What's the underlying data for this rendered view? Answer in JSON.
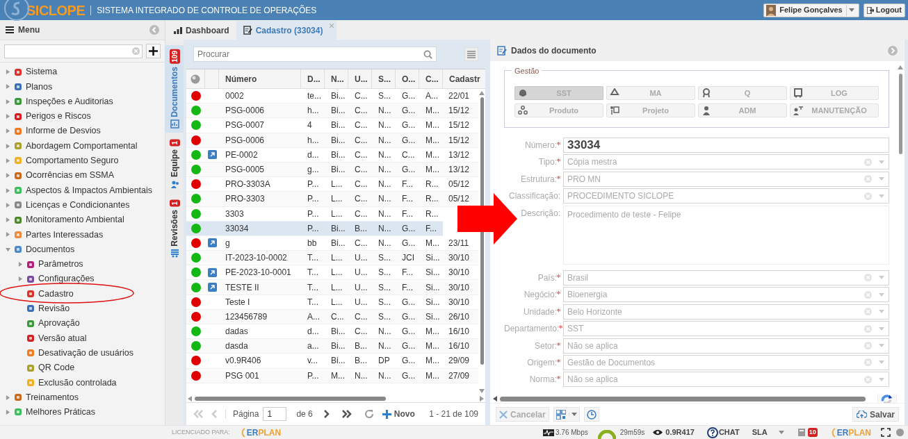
{
  "header": {
    "logo": "SICLOPE",
    "title": "SISTEMA INTEGRADO DE CONTROLE DE OPERAÇÕES",
    "user": "Felipe Gonçalves",
    "logout": "Logout"
  },
  "sidebar": {
    "title": "Menu",
    "items": [
      {
        "label": "Sistema",
        "expanded": false
      },
      {
        "label": "Planos",
        "expanded": false
      },
      {
        "label": "Inspeções e Auditorias",
        "expanded": false
      },
      {
        "label": "Perigos e Riscos",
        "expanded": false
      },
      {
        "label": "Informe de Desvios",
        "expanded": false
      },
      {
        "label": "Abordagem Comportamental",
        "expanded": false
      },
      {
        "label": "Comportamento Seguro",
        "expanded": false
      },
      {
        "label": "Ocorrências em SSMA",
        "expanded": false
      },
      {
        "label": "Aspectos & Impactos Ambientais",
        "expanded": false
      },
      {
        "label": "Licenças e Condicionantes",
        "expanded": false
      },
      {
        "label": "Monitoramento Ambiental",
        "expanded": false
      },
      {
        "label": "Partes Interessadas",
        "expanded": false
      },
      {
        "label": "Documentos",
        "expanded": true,
        "children": [
          {
            "label": "Parâmetros",
            "expanded": false
          },
          {
            "label": "Configurações",
            "expanded": false
          },
          {
            "label": "Cadastro"
          },
          {
            "label": "Revisão"
          },
          {
            "label": "Aprovação"
          },
          {
            "label": "Versão atual"
          },
          {
            "label": "Desativação de usuários"
          },
          {
            "label": "QR Code"
          },
          {
            "label": "Exclusão controlada"
          }
        ]
      },
      {
        "label": "Treinamentos",
        "expanded": false
      },
      {
        "label": "Melhores Práticas",
        "expanded": false
      }
    ]
  },
  "tabs": [
    {
      "label": "Dashboard",
      "selected": false,
      "closable": false
    },
    {
      "label": "Cadastro (33034)",
      "selected": true,
      "closable": true
    }
  ],
  "side_tabs": [
    {
      "label": "Documentos",
      "badge": "109",
      "selected": true
    },
    {
      "label": "Equipe",
      "badge": "1",
      "selected": false
    },
    {
      "label": "Revisões",
      "badge": "1",
      "selected": false
    }
  ],
  "grid": {
    "search": {
      "placeholder": "Procurar"
    },
    "columns": [
      "Número",
      "D...",
      "N...",
      "U...",
      "S...",
      "O...",
      "C...",
      "Cadastr"
    ],
    "rows": [
      {
        "color": "#e00000",
        "link": false,
        "selected": false,
        "cells": [
          "0002",
          "te...",
          "Bi...",
          "C...",
          "S...",
          "G...",
          "A...",
          "22/01"
        ]
      },
      {
        "color": "#14b814",
        "link": false,
        "selected": false,
        "cells": [
          "PSG-0006",
          "h...",
          "Bi...",
          "C...",
          "N...",
          "G...",
          "M...",
          "15/12"
        ]
      },
      {
        "color": "#14b814",
        "link": false,
        "selected": false,
        "cells": [
          "PSG-0007",
          "4",
          "Bi...",
          "C...",
          "N...",
          "G...",
          "M...",
          "15/12"
        ]
      },
      {
        "color": "#e00000",
        "link": false,
        "selected": false,
        "cells": [
          "PSG-0006",
          "h...",
          "Bi...",
          "C...",
          "N...",
          "G...",
          "M...",
          "15/12"
        ]
      },
      {
        "color": "#14b814",
        "link": true,
        "selected": false,
        "cells": [
          "PE-0002",
          "d...",
          "Bi...",
          "C...",
          "N...",
          "C...",
          "M...",
          "13/12"
        ]
      },
      {
        "color": "#14b814",
        "link": false,
        "selected": false,
        "cells": [
          "PSG-0005",
          "g...",
          "Bi...",
          "C...",
          "N...",
          "G...",
          "M...",
          "13/12"
        ]
      },
      {
        "color": "#e00000",
        "link": false,
        "selected": false,
        "cells": [
          "PRO-3303A",
          "P...",
          "L...",
          "C...",
          "N...",
          "F...",
          "R...",
          "05/12"
        ]
      },
      {
        "color": "#14b814",
        "link": false,
        "selected": false,
        "cells": [
          "PRO-3303",
          "P...",
          "L...",
          "C...",
          "N...",
          "F...",
          "R...",
          "05/12"
        ]
      },
      {
        "color": "#14b814",
        "link": false,
        "selected": false,
        "cells": [
          "3303",
          "P...",
          "L...",
          "C...",
          "N...",
          "F...",
          "R..."
        ]
      },
      {
        "color": "#14b814",
        "link": false,
        "selected": true,
        "cells": [
          "33034",
          "P...",
          "Bi...",
          "B...",
          "N...",
          "G...",
          "F..."
        ]
      },
      {
        "color": "#e00000",
        "link": true,
        "selected": false,
        "cells": [
          "g",
          "bb",
          "Bi...",
          "C...",
          "N...",
          "G...",
          "M...",
          "23/11"
        ]
      },
      {
        "color": "#14b814",
        "link": false,
        "selected": false,
        "cells": [
          "IT-2023-10-0002",
          "T...",
          "L...",
          "U...",
          "S...",
          "JCI",
          "Si...",
          "30/10"
        ]
      },
      {
        "color": "#14b814",
        "link": true,
        "selected": false,
        "cells": [
          "PE-2023-10-0001",
          "T...",
          "L...",
          "U...",
          "S...",
          "F...",
          "Si...",
          "30/10"
        ]
      },
      {
        "color": "#14b814",
        "link": true,
        "selected": false,
        "cells": [
          "TESTE II",
          "T...",
          "L...",
          "U...",
          "S...",
          "F...",
          "Si...",
          "30/10"
        ]
      },
      {
        "color": "#e00000",
        "link": false,
        "selected": false,
        "cells": [
          "Teste I",
          "T...",
          "L...",
          "U...",
          "S...",
          "G...",
          "Si...",
          "30/10"
        ]
      },
      {
        "color": "#e00000",
        "link": false,
        "selected": false,
        "cells": [
          "123456789",
          "A...",
          "C...",
          "C...",
          "S...",
          "G...",
          "Si...",
          "26/10"
        ]
      },
      {
        "color": "#14b814",
        "link": false,
        "selected": false,
        "cells": [
          "dadas",
          "d...",
          "Bi...",
          "C...",
          "N...",
          "G...",
          "M...",
          "16/10"
        ]
      },
      {
        "color": "#14b814",
        "link": false,
        "selected": false,
        "cells": [
          "dasda",
          "a...",
          "Bi...",
          "B...",
          "N...",
          "G...",
          "M...",
          "16/10"
        ]
      },
      {
        "color": "#e00000",
        "link": false,
        "selected": false,
        "cells": [
          "v0.9R406",
          "v...",
          "Bi...",
          "B...",
          "DP",
          "G...",
          "M...",
          "29/09"
        ]
      },
      {
        "color": "#e00000",
        "link": false,
        "selected": false,
        "cells": [
          "PSG 001",
          "P...",
          "M...",
          "N...",
          "N...",
          "G...",
          "M...",
          "27/09"
        ]
      }
    ],
    "pager": {
      "page_label": "Página",
      "page": "1",
      "of": "de 6",
      "new": "Novo",
      "range": "1 - 21 de 109"
    }
  },
  "form": {
    "title": "Dados do documento",
    "legend": "Gestão",
    "gestao": [
      {
        "label": "SST",
        "selected": true
      },
      {
        "label": "MA",
        "selected": false
      },
      {
        "label": "Q",
        "selected": false
      },
      {
        "label": "LOG",
        "selected": false
      },
      {
        "label": "Produto",
        "selected": false
      },
      {
        "label": "Projeto",
        "selected": false
      },
      {
        "label": "ADM",
        "selected": false
      },
      {
        "label": "MANUTENÇÃO",
        "selected": false
      }
    ],
    "fields": [
      {
        "label": "Número:",
        "required": true,
        "kind": "number",
        "value": "33034"
      },
      {
        "label": "Tipo:",
        "required": true,
        "kind": "select",
        "value": "Cópia mestra"
      },
      {
        "label": "Estrutura:",
        "required": true,
        "kind": "select",
        "value": "PRO MN"
      },
      {
        "label": "Classificação:",
        "required": false,
        "kind": "select",
        "value": "PROCEDIMENTO SICLOPE"
      },
      {
        "label": "Descrição:",
        "required": false,
        "kind": "textarea",
        "value": "Procedimento de teste - Felipe"
      },
      {
        "label": "País:",
        "required": true,
        "kind": "select",
        "value": "Brasil"
      },
      {
        "label": "Negócio:",
        "required": true,
        "kind": "select",
        "value": "Bioenergia"
      },
      {
        "label": "Unidade:",
        "required": true,
        "kind": "select",
        "value": "Belo Horizonte"
      },
      {
        "label": "Departamento:",
        "required": true,
        "kind": "select",
        "value": "SST"
      },
      {
        "label": "Setor:",
        "required": true,
        "kind": "select",
        "value": "Não se aplica"
      },
      {
        "label": "Origem:",
        "required": true,
        "kind": "select",
        "value": "Gestão de Documentos"
      },
      {
        "label": "Norma:",
        "required": true,
        "kind": "select",
        "value": "Não se aplica"
      }
    ],
    "cancel": "Cancelar",
    "save": "Salvar"
  },
  "status_bar": {
    "licensed": "LICENCIADO PARA:",
    "brand": [
      "ER",
      "PLAN"
    ],
    "speed": "3.76 Mbps",
    "timer": "29m59s",
    "version": "0.9R417",
    "chat": "CHAT",
    "sla": "SLA",
    "badge": "10",
    "brand2": [
      "ER",
      "PLAN"
    ]
  }
}
